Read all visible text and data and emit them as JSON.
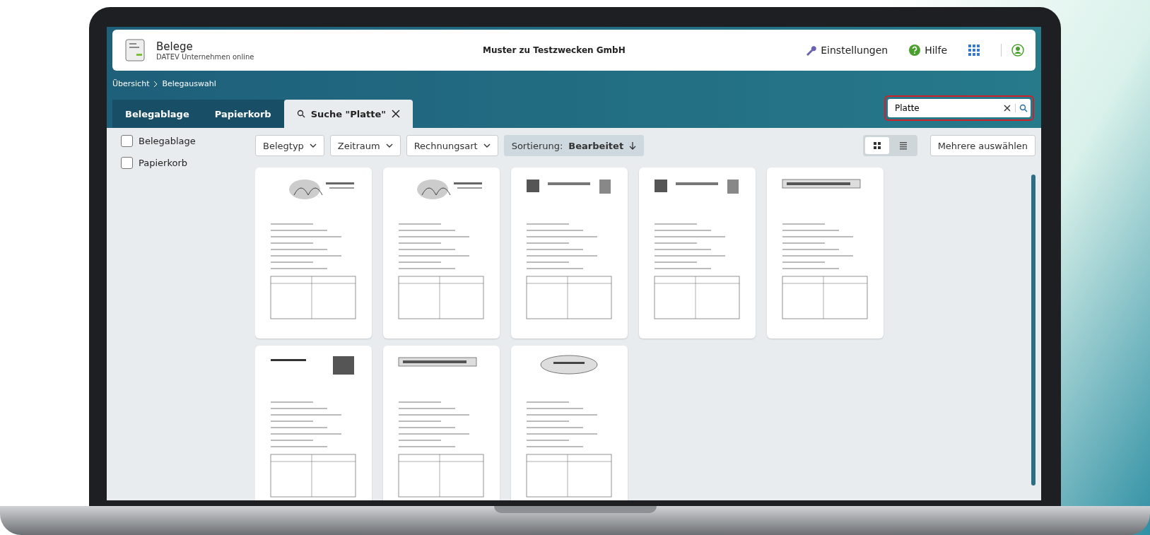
{
  "header": {
    "app_title": "Belege",
    "app_subtitle": "DATEV Unternehmen online",
    "company": "Muster zu Testzwecken GmbH",
    "settings_label": "Einstellungen",
    "help_label": "Hilfe"
  },
  "breadcrumb": [
    "Übersicht",
    "Belegauswahl"
  ],
  "tabs": [
    {
      "label": "Belegablage",
      "selected": false,
      "kind": "plain"
    },
    {
      "label": "Papierkorb",
      "selected": false,
      "kind": "plain"
    },
    {
      "label": "Suche \"Platte\"",
      "selected": true,
      "kind": "search"
    }
  ],
  "search": {
    "value": "Platte",
    "highlighted": true
  },
  "sidebar": [
    {
      "label": "Belegablage",
      "checked": false
    },
    {
      "label": "Papierkorb",
      "checked": false
    }
  ],
  "filters": [
    "Belegtyp",
    "Zeitraum",
    "Rechnungsart"
  ],
  "sort": {
    "label": "Sortierung:",
    "value": "Bearbeitet"
  },
  "view_modes": [
    {
      "kind": "grid",
      "selected": true
    },
    {
      "kind": "list",
      "selected": false
    }
  ],
  "select_multiple": "Mehrere auswählen",
  "documents": [
    {
      "kind": "leaf"
    },
    {
      "kind": "leaf"
    },
    {
      "kind": "sawmill"
    },
    {
      "kind": "sawmill"
    },
    {
      "kind": "banner"
    },
    {
      "kind": "stamp"
    },
    {
      "kind": "banner"
    },
    {
      "kind": "oval"
    }
  ]
}
